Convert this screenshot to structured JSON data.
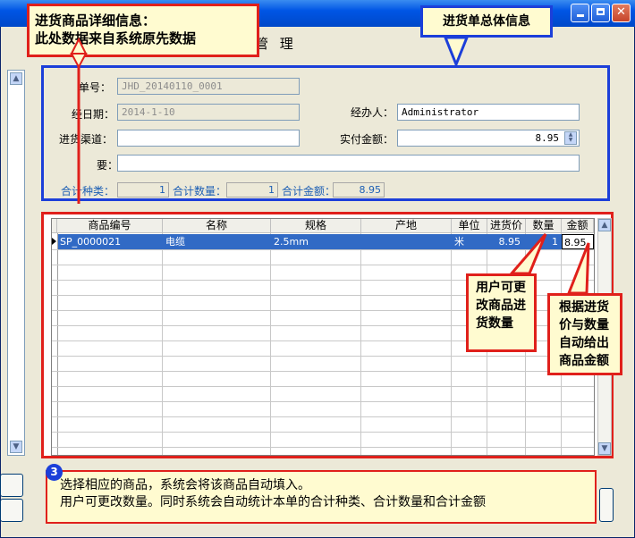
{
  "window": {
    "title_partial": "管 理",
    "buttons": [
      "minimize",
      "maximize",
      "close"
    ]
  },
  "form": {
    "order_no_label": "单号：",
    "order_no_value": "JHD_20140110_0001",
    "date_label": "经日期：",
    "date_value": "2014-1-10",
    "handler_label": "经办人：",
    "handler_value": "Administrator",
    "channel_label": "进货渠道：",
    "channel_value": "",
    "paid_label": "实付金额：",
    "paid_value": "8.95",
    "summary_label": "要：",
    "summary_value": "",
    "total_kinds_label": "合计种类：",
    "total_kinds_value": "1",
    "total_qty_label": "合计数量：",
    "total_qty_value": "1",
    "total_amount_label": "合计金额：",
    "total_amount_value": "8.95"
  },
  "grid": {
    "columns": [
      "商品编号",
      "名称",
      "规格",
      "产地",
      "单位",
      "进货价",
      "数量",
      "金额"
    ],
    "rows": [
      [
        "SP_0000021",
        "电缆",
        "2.5mm",
        "",
        "米",
        "8.95",
        "1",
        "8.95"
      ]
    ]
  },
  "annotations": {
    "detail_title": "进货商品详细信息：",
    "detail_body": "此处数据来自系统原先数据",
    "overall": "进货单总体信息",
    "qty_note": "用户可更改商品进货数量",
    "amount_note": "根据进货价与数量自动给出商品金额",
    "step_number": "3",
    "bottom_line1": "选择相应的商品，系统会将该商品自动填入。",
    "bottom_line2": "用户可更改数量。同时系统会自动统计本单的合计种类、合计数量和合计金额"
  },
  "colors": {
    "annotation_red": "#e0201b",
    "annotation_blue": "#1c3fd9",
    "annotation_fill": "#fffbd0",
    "selected_row": "#316ac5",
    "window_bg": "#ece9d8"
  }
}
